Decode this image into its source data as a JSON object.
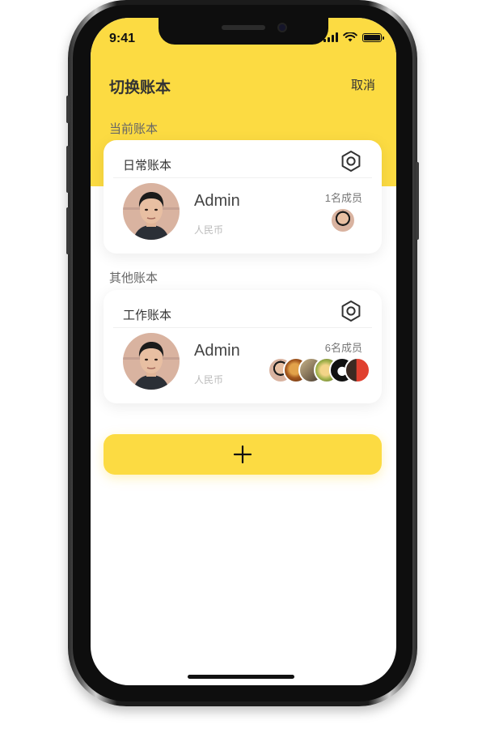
{
  "status_bar": {
    "time": "9:41"
  },
  "header": {
    "title": "切换账本",
    "cancel_label": "取消"
  },
  "current_section": {
    "label": "当前账本",
    "book": {
      "name": "日常账本",
      "owner": "Admin",
      "currency": "人民币",
      "members_text": "1名成员",
      "member_count": 1
    }
  },
  "other_section": {
    "label": "其他账本",
    "books": [
      {
        "name": "工作账本",
        "owner": "Admin",
        "currency": "人民币",
        "members_text": "6名成员",
        "member_count": 6
      }
    ]
  },
  "add_button": {
    "icon": "plus-icon"
  },
  "colors": {
    "accent": "#FCDB42",
    "text": "#333333",
    "muted": "#999999"
  }
}
